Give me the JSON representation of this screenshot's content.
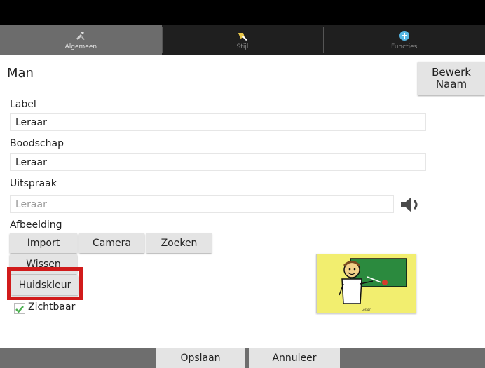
{
  "tabs": [
    {
      "label": "Algemeen",
      "icon": "tools-icon",
      "active": true
    },
    {
      "label": "Stijl",
      "icon": "brush-icon",
      "active": false
    },
    {
      "label": "Functies",
      "icon": "plus-circle-icon",
      "active": false
    }
  ],
  "header": {
    "name": "Man",
    "edit_name_line1": "Bewerk",
    "edit_name_line2": "Naam"
  },
  "fields": {
    "label": {
      "title": "Label",
      "value": "Leraar"
    },
    "message": {
      "title": "Boodschap",
      "value": "Leraar"
    },
    "pronunciation": {
      "title": "Uitspraak",
      "placeholder": "Leraar"
    }
  },
  "image": {
    "title": "Afbeelding",
    "import": "Import",
    "camera": "Camera",
    "search": "Zoeken",
    "clear": "Wissen",
    "skin_color": "Huidskleur",
    "visible_label": "Zichtbaar",
    "visible_checked": true,
    "preview_caption": "Leraar"
  },
  "footer": {
    "save": "Opslaan",
    "cancel": "Annuleer"
  },
  "colors": {
    "highlight": "#d11b1b",
    "preview_bg": "#f2ee6f",
    "check": "#4caf50"
  }
}
